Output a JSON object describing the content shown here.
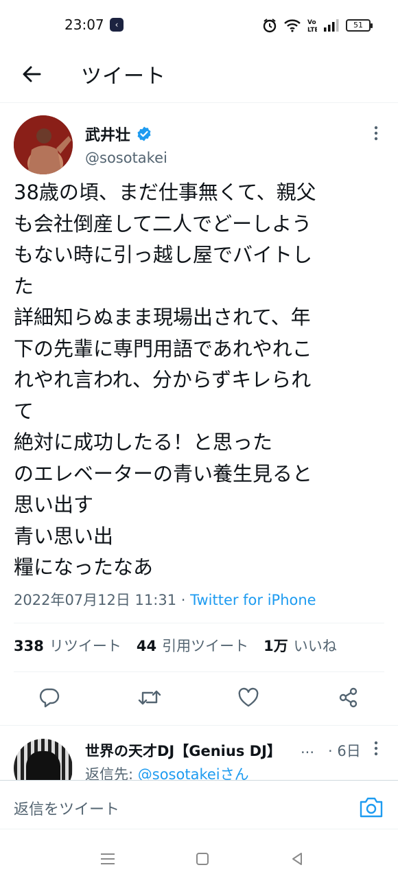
{
  "status_bar": {
    "time": "23:07",
    "app_icon": "app-notification-icon",
    "battery": "51",
    "network": "VoLTE"
  },
  "header": {
    "title": "ツイート",
    "back_icon": "back-arrow-icon"
  },
  "tweet": {
    "author_name": "武井壮",
    "author_handle": "@sosotakei",
    "verified": true,
    "text_lines": [
      "38歳の頃、まだ仕事無くて、親父",
      "も会社倒産して二人でどーしよう",
      "もない時に引っ越し屋でバイトし",
      "た",
      "詳細知らぬまま現場出されて、年",
      "下の先輩に専門用語であれやれこ",
      "れやれ言われ、分からずキレられ",
      "て",
      "絶対に成功したる！と思った",
      "のエレベーターの青い養生見ると",
      "思い出す",
      "青い思い出",
      "糧になったなあ"
    ],
    "timestamp": "2022年07月12日 11:31 · ",
    "source": "Twitter for iPhone",
    "stats": {
      "retweets_count": "338",
      "retweets_label": "リツイート",
      "quotes_count": "44",
      "quotes_label": "引用ツイート",
      "likes_count": "1万",
      "likes_label": "いいね"
    }
  },
  "reply": {
    "author_name": "世界の天才DJ【Genius DJ】",
    "ellipsis": "...",
    "time": "· 6日",
    "reply_to_prefix": "返信先: ",
    "reply_to_mention": "@sosotakei",
    "reply_to_suffix": "さん"
  },
  "compose": {
    "placeholder": "返信をツイート"
  },
  "colors": {
    "accent": "#1d9bf0",
    "text": "#0f1419",
    "secondary": "#536471",
    "divider": "#eff3f4"
  }
}
